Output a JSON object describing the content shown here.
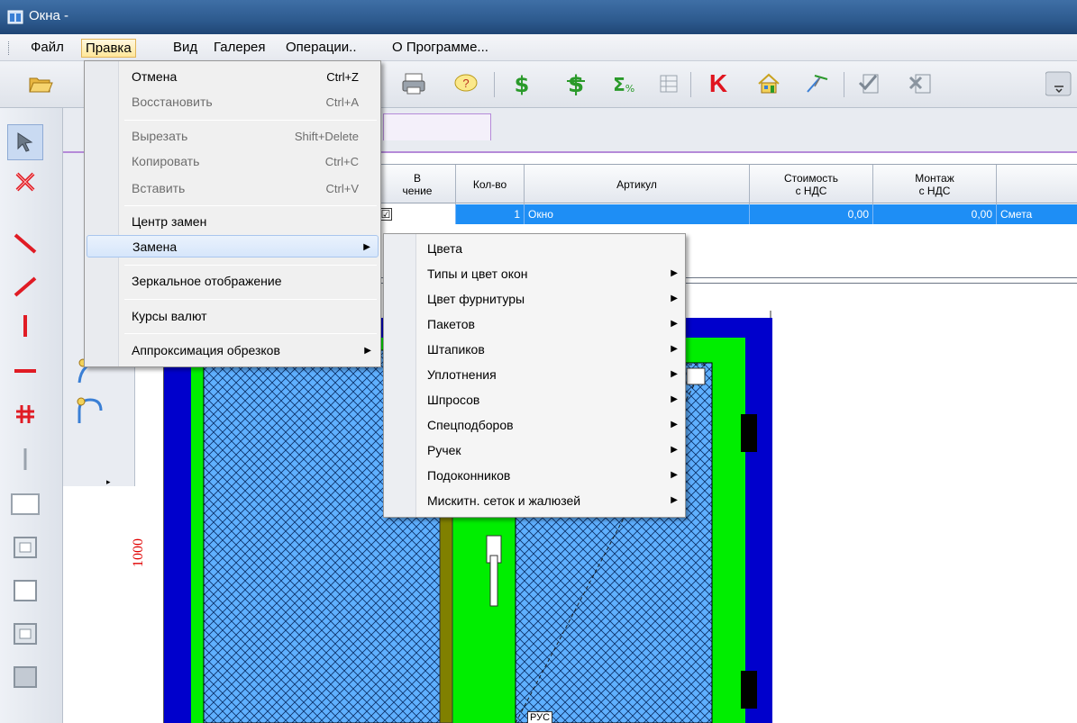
{
  "window": {
    "title": "Окна -"
  },
  "menubar": {
    "items": [
      {
        "label": "Файл"
      },
      {
        "label": "Правка"
      },
      {
        "label": "Вид"
      },
      {
        "label": "Галерея"
      },
      {
        "label": "Операции.."
      },
      {
        "label": "О Программе..."
      }
    ]
  },
  "toolbar": {
    "buttons": [
      "open-folder",
      "save",
      "print",
      "comment",
      "dollar",
      "currency-conversion",
      "sum-percent",
      "table",
      "K",
      "house",
      "tool",
      "approve",
      "delete"
    ]
  },
  "table": {
    "headers": [
      "В\nвычисление",
      "Кол-во",
      "Артикул",
      "Стоимость\nс НДС",
      "Монтаж\nс НДС",
      ""
    ],
    "header_col1_visible": "В\nчение",
    "rows": [
      {
        "checked": "☑",
        "qty": "1",
        "article": "Окно",
        "cost": "0,00",
        "install": "0,00",
        "extra": "Смета"
      }
    ]
  },
  "drawing": {
    "dimension_label": "1000",
    "tag_bottom": "РУС",
    "colors": {
      "frame": "#0000cc",
      "sash": "#00ee00",
      "glass": "#66b3ff",
      "impost": "#808000"
    }
  },
  "edit_menu": {
    "items": [
      {
        "label": "Отмена",
        "shortcut": "Ctrl+Z",
        "disabled": false
      },
      {
        "label": "Восстановить",
        "shortcut": "Ctrl+A",
        "disabled": true
      },
      {
        "label": "Вырезать",
        "shortcut": "Shift+Delete",
        "disabled": true
      },
      {
        "label": "Копировать",
        "shortcut": "Ctrl+C",
        "disabled": true
      },
      {
        "label": "Вставить",
        "shortcut": "Ctrl+V",
        "disabled": true
      },
      {
        "label": "Центр замен",
        "shortcut": "",
        "disabled": false
      },
      {
        "label": "Замена",
        "shortcut": "",
        "disabled": false,
        "submenu": true
      },
      {
        "label": "Зеркальное отображение",
        "shortcut": "",
        "disabled": false
      },
      {
        "label": "Курсы валют",
        "shortcut": "",
        "disabled": false
      },
      {
        "label": "Аппроксимация обрезков",
        "shortcut": "",
        "disabled": false,
        "submenu": true
      }
    ]
  },
  "replace_submenu": {
    "items": [
      {
        "label": "Цвета",
        "submenu": false
      },
      {
        "label": "Типы и цвет окон",
        "submenu": true
      },
      {
        "label": "Цвет фурнитуры",
        "submenu": true
      },
      {
        "label": "Пакетов",
        "submenu": true
      },
      {
        "label": "Штапиков",
        "submenu": true
      },
      {
        "label": "Уплотнения",
        "submenu": true
      },
      {
        "label": "Шпросов",
        "submenu": true
      },
      {
        "label": "Спецподборов",
        "submenu": true
      },
      {
        "label": "Ручек",
        "submenu": true
      },
      {
        "label": "Подоконников",
        "submenu": true
      },
      {
        "label": "Мискитн. сеток и жалюзей",
        "submenu": true
      }
    ]
  },
  "toolbar_text": {
    "k_label": "K"
  }
}
